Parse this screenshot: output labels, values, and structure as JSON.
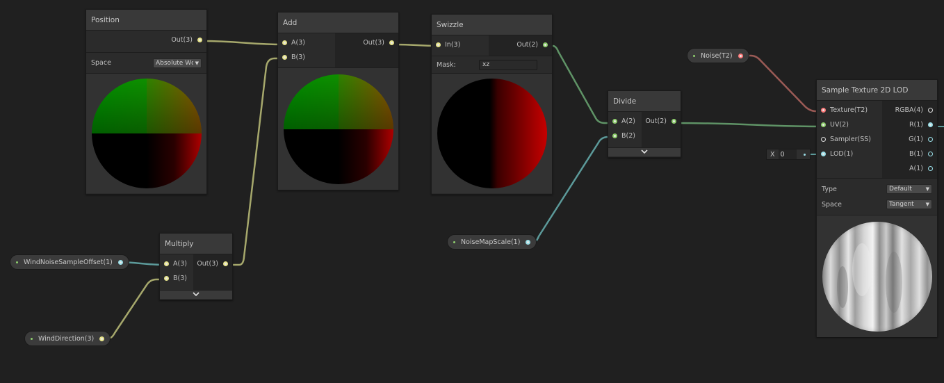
{
  "nodes": {
    "position": {
      "title": "Position",
      "output": "Out(3)",
      "space_label": "Space",
      "space_value": "Absolute Wc"
    },
    "add": {
      "title": "Add",
      "inputs": [
        "A(3)",
        "B(3)"
      ],
      "output": "Out(3)"
    },
    "swizzle": {
      "title": "Swizzle",
      "input": "In(3)",
      "output": "Out(2)",
      "mask_label": "Mask:",
      "mask_value": "xz"
    },
    "divide": {
      "title": "Divide",
      "inputs": [
        "A(2)",
        "B(2)"
      ],
      "output": "Out(2)"
    },
    "multiply": {
      "title": "Multiply",
      "inputs": [
        "A(3)",
        "B(3)"
      ],
      "output": "Out(3)"
    },
    "sample_texture": {
      "title": "Sample Texture 2D LOD",
      "inputs": [
        "Texture(T2)",
        "UV(2)",
        "Sampler(SS)",
        "LOD(1)"
      ],
      "outputs": [
        "RGBA(4)",
        "R(1)",
        "G(1)",
        "B(1)",
        "A(1)"
      ],
      "type_label": "Type",
      "type_value": "Default",
      "space_label": "Space",
      "space_value": "Tangent",
      "lod_x_label": "X",
      "lod_x_value": "0"
    }
  },
  "properties": {
    "noise": "Noise(T2)",
    "noise_map_scale": "NoiseMapScale(1)",
    "wind_noise_sample_offset": "WindNoiseSampleOffset(1)",
    "wind_direction": "WindDirection(3)"
  },
  "colors": {
    "vector3": "#e7e48c",
    "vector2": "#8fcf6e",
    "vector1": "#9adfe8",
    "texture": "#ff7b7b",
    "sampler": "#dcdcdc",
    "wire_v3": "#a6a86c",
    "wire_v2": "#5f9366",
    "wire_tex": "#9a5a55",
    "wire_v1": "#5c9a9a"
  },
  "icons": {
    "expand": "chevron-down-icon",
    "dropdown": "caret-down-icon"
  }
}
